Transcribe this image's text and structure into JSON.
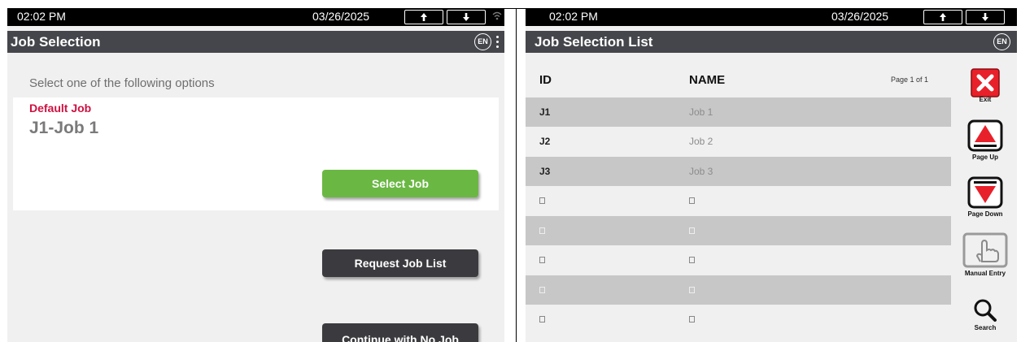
{
  "left": {
    "status": {
      "time": "02:02 PM",
      "date": "03/26/2025"
    },
    "title": "Job Selection",
    "lang": "EN",
    "instruction": "Select one of the following options",
    "default_job_label": "Default Job",
    "default_job_value": "J1-Job 1",
    "buttons": {
      "select_job": "Select Job",
      "request_job_list": "Request Job List",
      "continue_no_job": "Continue with No Job"
    }
  },
  "right": {
    "status": {
      "time": "02:02 PM",
      "date": "03/26/2025"
    },
    "title": "Job Selection List",
    "lang": "EN",
    "columns": {
      "id": "ID",
      "name": "NAME"
    },
    "page_indicator": "Page 1 of 1",
    "rows": [
      {
        "id": "J1",
        "name": "Job 1"
      },
      {
        "id": "J2",
        "name": "Job 2"
      },
      {
        "id": "J3",
        "name": "Job 3"
      },
      {
        "id": "",
        "name": ""
      },
      {
        "id": "",
        "name": ""
      },
      {
        "id": "",
        "name": ""
      },
      {
        "id": "",
        "name": ""
      },
      {
        "id": "",
        "name": ""
      }
    ],
    "side_buttons": {
      "exit": "Exit",
      "page_up": "Page Up",
      "page_down": "Page Down",
      "manual_entry": "Manual Entry",
      "search": "Search"
    }
  },
  "colors": {
    "titlebar": "#45464b",
    "select_button": "#6ab843",
    "dark_button": "#3b3b3f",
    "default_job_label": "#d0103f",
    "exit_red": "#e8202a",
    "row_grey": "#c7c7c7"
  },
  "icons": [
    "up-arrow-icon",
    "down-arrow-icon",
    "wifi-icon",
    "language-icon",
    "kebab-menu-icon",
    "exit-icon",
    "page-up-icon",
    "page-down-icon",
    "manual-entry-icon",
    "search-icon"
  ]
}
